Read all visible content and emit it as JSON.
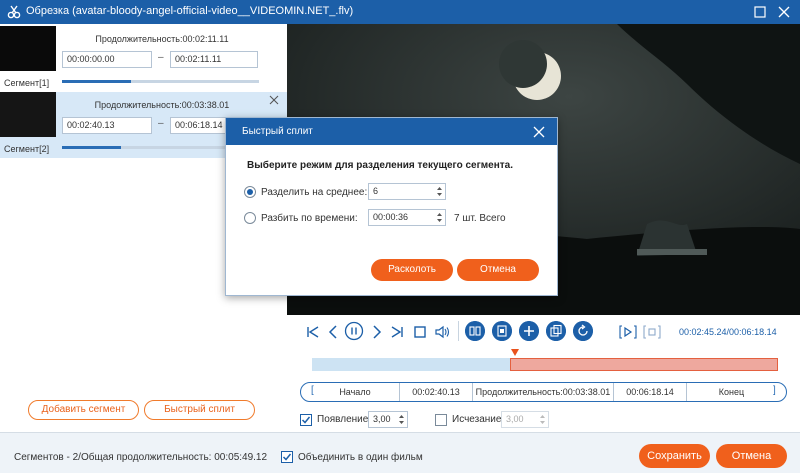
{
  "window": {
    "title": "Обрезка (avatar-bloody-angel-official-video__VIDEOMIN.NET_.flv)",
    "app_icon": "scissors-icon",
    "controls": [
      "maximize-icon",
      "close-icon"
    ]
  },
  "segments": [
    {
      "label": "Сегмент[1]",
      "duration_text": "Продолжительность:00:02:11.11",
      "start": "00:00:00.00",
      "end": "00:02:11.11",
      "dash": "–",
      "progress": 0.35,
      "selected": false
    },
    {
      "label": "Сегмент[2]",
      "duration_text": "Продолжительность:00:03:38.01",
      "start": "00:02:40.13",
      "end": "00:06:18.14",
      "dash": "–",
      "progress": 0.3,
      "selected": true
    }
  ],
  "left_buttons": {
    "add_segment": "Добавить сегмент",
    "quick_split": "Быстрый сплит"
  },
  "player": {
    "timecode": "00:02:45.24/00:06:18.14",
    "timeline_selection": {
      "start_fraction": 0.425,
      "end_fraction": 1.0
    },
    "playhead_fraction": 0.436
  },
  "segment_bar": {
    "start_label": "Начало",
    "start_value": "00:02:40.13",
    "duration": "Продолжительность:00:03:38.01",
    "end_value": "00:06:18.14",
    "end_label": "Конец"
  },
  "fade": {
    "fade_in_label": "Появление",
    "fade_in_checked": true,
    "fade_in_value": "3,00",
    "fade_out_label": "Исчезание",
    "fade_out_checked": false,
    "fade_out_value": "3,00"
  },
  "footer": {
    "stats": "Сегментов - 2/Общая продолжительность: 00:05:49.12",
    "merge_label": "Объединить в один фильм",
    "merge_checked": true,
    "save": "Сохранить",
    "cancel": "Отмена"
  },
  "dialog": {
    "title": "Быстрый сплит",
    "prompt": "Выберите режим для разделения текущего сегмента.",
    "option_avg_label": "Разделить на среднее:",
    "option_avg_value": "6",
    "option_avg_selected": true,
    "option_time_label": "Разбить по времени:",
    "option_time_value": "00:00:36",
    "option_time_selected": false,
    "total_text": "7 шт. Всего",
    "split_button": "Расколоть",
    "cancel_button": "Отмена"
  },
  "colors": {
    "accent_blue": "#1c5fa8",
    "accent_orange": "#f0601c",
    "selection_bg": "#d7e8f7"
  }
}
